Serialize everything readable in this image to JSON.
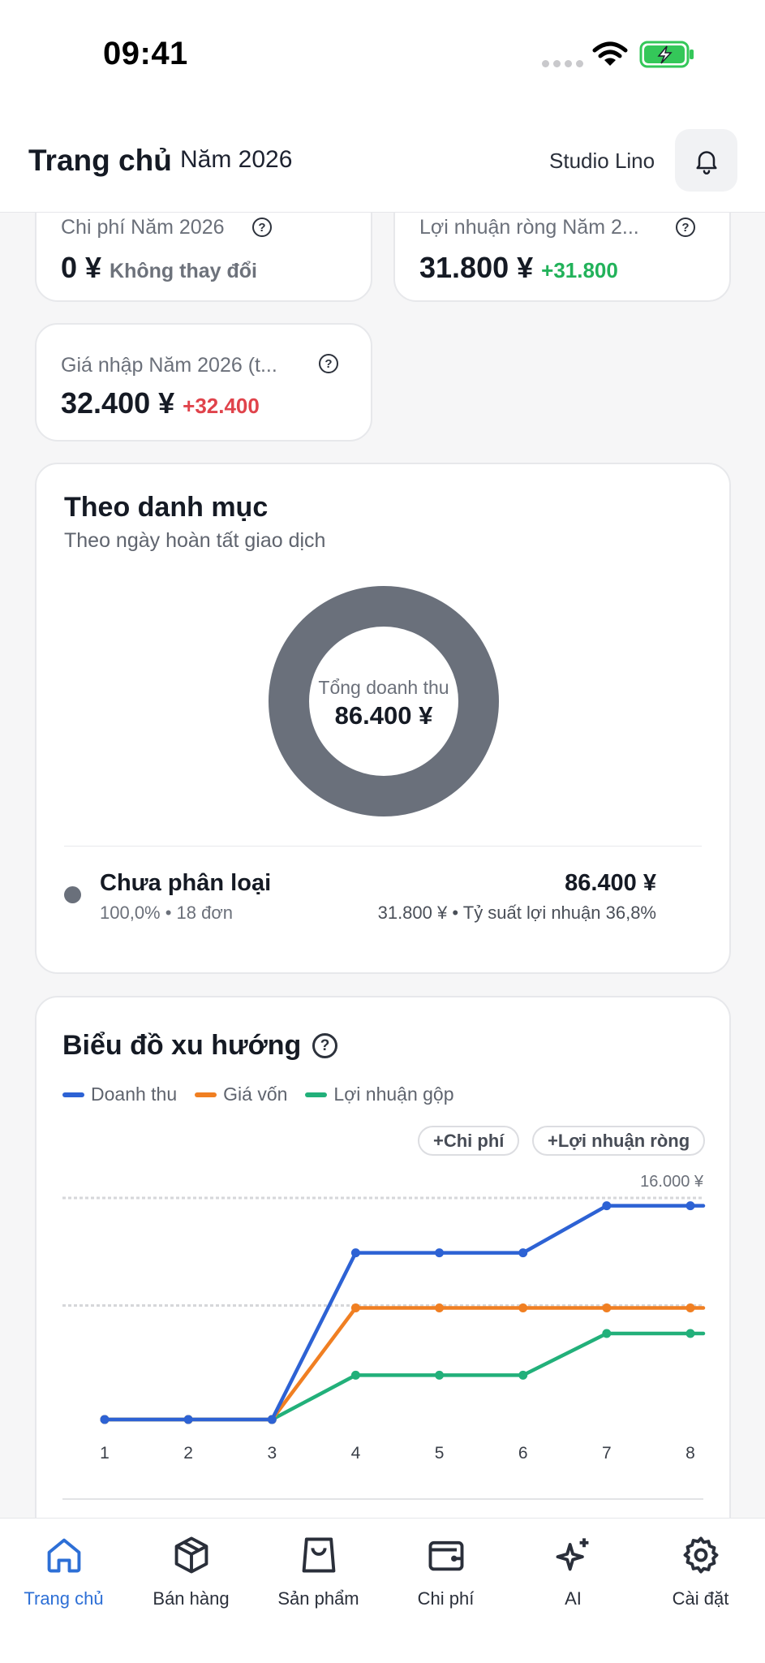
{
  "status_bar": {
    "time": "09:41"
  },
  "header": {
    "title": "Trang chủ",
    "year": "Năm 2026",
    "studio": "Studio Lino",
    "bell_icon": "bell-icon"
  },
  "stats": [
    {
      "label": "Chi phí Năm 2026",
      "value": "0 ¥",
      "delta": "Không thay đổi",
      "delta_tone": "neutral"
    },
    {
      "label": "Lợi nhuận ròng Năm 2...",
      "value": "31.800 ¥",
      "delta": "+31.800",
      "delta_tone": "green"
    },
    {
      "label": "Giá nhập Năm 2026 (t...",
      "value": "32.400 ¥",
      "delta": "+32.400",
      "delta_tone": "red"
    }
  ],
  "category": {
    "title": "Theo danh mục",
    "subtitle": "Theo ngày hoàn tất giao dịch",
    "donut_label": "Tổng doanh thu",
    "donut_value": "86.400 ¥",
    "item": {
      "name": "Chưa phân loại",
      "meta": "100,0% • 18 đơn",
      "amount": "86.400 ¥",
      "margin": "31.800 ¥ • Tỷ suất lợi nhuận 36,8%",
      "color": "#6a707b"
    }
  },
  "trend": {
    "title": "Biểu đồ xu hướng",
    "legend": [
      {
        "name": "Doanh thu",
        "color": "#2d62d4"
      },
      {
        "name": "Giá vốn",
        "color": "#f07f22"
      },
      {
        "name": "Lợi nhuận gộp",
        "color": "#22b07a"
      }
    ],
    "chips": {
      "expense": "+Chi phí",
      "net_profit": "+Lợi nhuận ròng"
    },
    "y_label": "16.000 ¥"
  },
  "chart_data": {
    "type": "line",
    "x": [
      1,
      2,
      3,
      4,
      5,
      6,
      7,
      8
    ],
    "ylim": [
      0,
      16000
    ],
    "grid_values": [
      8000,
      16000
    ],
    "top_tick": "16.000 ¥",
    "series": [
      {
        "name": "Doanh thu",
        "color": "#2d62d4",
        "values": [
          0,
          0,
          0,
          12400,
          12400,
          12400,
          15900,
          15900
        ]
      },
      {
        "name": "Giá vốn",
        "color": "#f07f22",
        "values": [
          0,
          0,
          0,
          8300,
          8300,
          8300,
          8300,
          8300
        ]
      },
      {
        "name": "Lợi nhuận gộp",
        "color": "#22b07a",
        "values": [
          0,
          0,
          0,
          3300,
          3300,
          3300,
          6400,
          6400
        ]
      }
    ]
  },
  "nav": [
    {
      "label": "Trang chủ",
      "icon": "home-icon",
      "active": true
    },
    {
      "label": "Bán hàng",
      "icon": "box-icon",
      "active": false
    },
    {
      "label": "Sản phẩm",
      "icon": "bag-icon",
      "active": false
    },
    {
      "label": "Chi phí",
      "icon": "wallet-icon",
      "active": false
    },
    {
      "label": "AI",
      "icon": "sparkles-icon",
      "active": false
    },
    {
      "label": "Cài đặt",
      "icon": "gear-icon",
      "active": false
    }
  ]
}
